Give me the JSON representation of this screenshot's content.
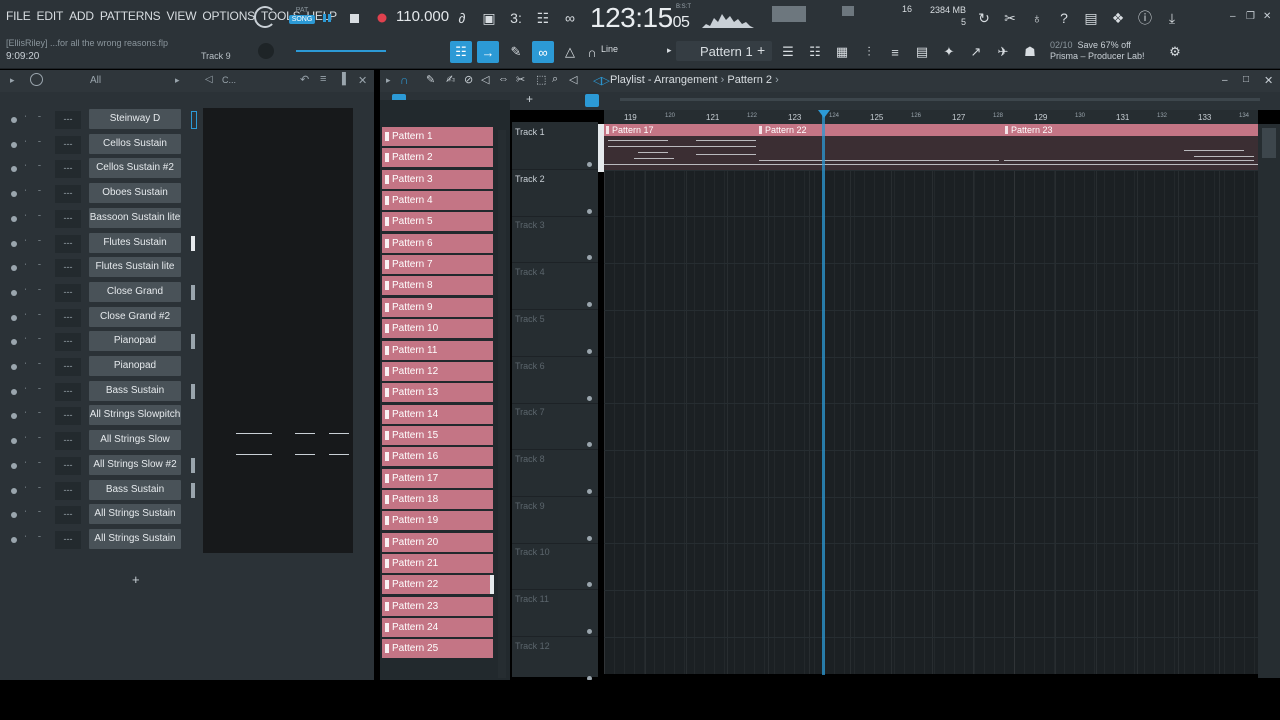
{
  "menu": [
    "FILE",
    "EDIT",
    "ADD",
    "PATTERNS",
    "VIEW",
    "OPTIONS",
    "TOOLS",
    "HELP"
  ],
  "transport": {
    "pat_label": "PAT",
    "song_label": "SONG",
    "tempo": "110.000",
    "time_main": "123:15",
    "time_small": "05",
    "bst": "B:S:T"
  },
  "cpu": "16",
  "memory": "2384 MB",
  "memory_sub": "5",
  "song": {
    "file": "[EllisRiley] ...for all the wrong reasons.flp",
    "time": "9:09:20",
    "hint": "Track 9"
  },
  "snap": "Line",
  "pattern_selector": "Pattern 1",
  "news": {
    "count": "02/10",
    "text": "Save 67% off",
    "line2": "Prisma – Producer Lab!"
  },
  "rack": {
    "filter": "All",
    "filter_right": "C..."
  },
  "channels": [
    "Steinway D",
    "Cellos Sustain",
    "Cellos Sustain #2",
    "Oboes Sustain",
    "Bassoon Sustain lite",
    "Flutes Sustain",
    "Flutes Sustain lite",
    "Close Grand",
    "Close Grand #2",
    "Pianopad",
    "Pianopad",
    "Bass Sustain",
    "All Strings Slowpitch",
    "All Strings Slow",
    "All Strings Slow #2",
    "Bass Sustain",
    "All Strings Sustain",
    "All Strings Sustain"
  ],
  "channel_group": "---",
  "add_channel": "+",
  "playlist": {
    "title": "Playlist - Arrangement",
    "breadcrumb": "Pattern 2"
  },
  "patterns": [
    "Pattern 1",
    "Pattern 2",
    "Pattern 3",
    "Pattern 4",
    "Pattern 5",
    "Pattern 6",
    "Pattern 7",
    "Pattern 8",
    "Pattern 9",
    "Pattern 10",
    "Pattern 11",
    "Pattern 12",
    "Pattern 13",
    "Pattern 14",
    "Pattern 15",
    "Pattern 16",
    "Pattern 17",
    "Pattern 18",
    "Pattern 19",
    "Pattern 20",
    "Pattern 21",
    "Pattern 22",
    "Pattern 23",
    "Pattern 24",
    "Pattern 25"
  ],
  "tracks": [
    "Track 1",
    "Track 2",
    "Track 3",
    "Track 4",
    "Track 5",
    "Track 6",
    "Track 7",
    "Track 8",
    "Track 9",
    "Track 10",
    "Track 11",
    "Track 12"
  ],
  "ruler": [
    "119",
    "120",
    "121",
    "122",
    "123",
    "124",
    "125",
    "126",
    "127",
    "128",
    "129",
    "130",
    "131",
    "132",
    "133",
    "134"
  ],
  "clips": [
    {
      "label": "Pattern 17"
    },
    {
      "label": "Pattern 22"
    },
    {
      "label": "Pattern 23"
    }
  ],
  "colors": {
    "clip": "#c47585",
    "accent": "#2c9ad6",
    "panel": "#2b3237"
  }
}
